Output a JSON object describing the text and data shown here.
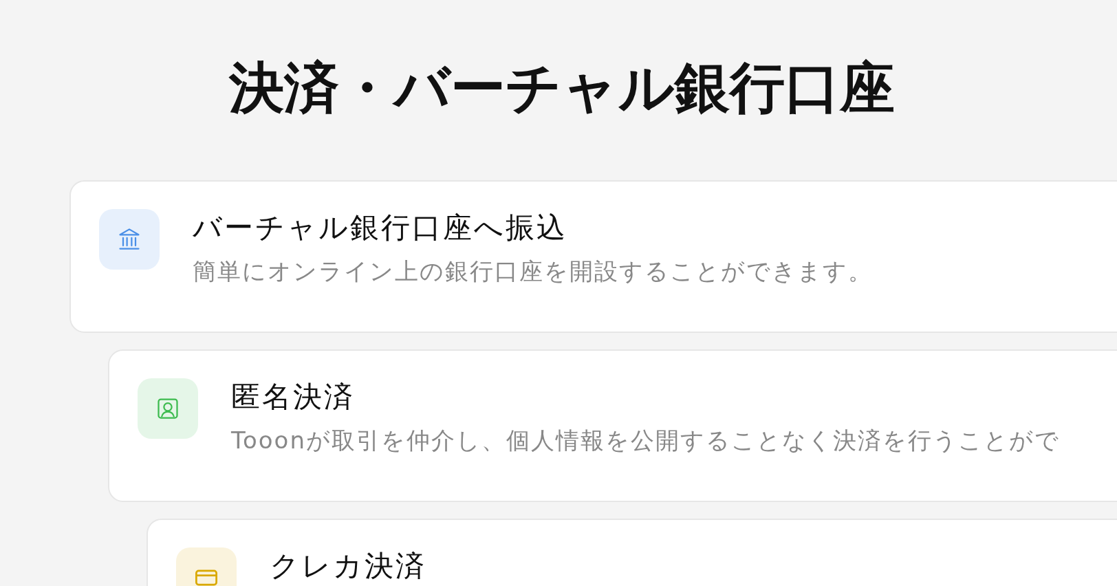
{
  "heading": "決済・バーチャル銀行口座",
  "methods": [
    {
      "kind": "bank",
      "color": "#4a8fe7",
      "title": "バーチャル銀行口座へ振込",
      "description": "簡単にオンライン上の銀行口座を開設することができます。"
    },
    {
      "kind": "person",
      "color": "#3dbb4f",
      "title": "匿名決済",
      "description": "Tooonが取引を仲介し、個人情報を公開することなく決済を行うことがで"
    },
    {
      "kind": "card",
      "color": "#d9a800",
      "title": "クレカ決済"
    }
  ]
}
